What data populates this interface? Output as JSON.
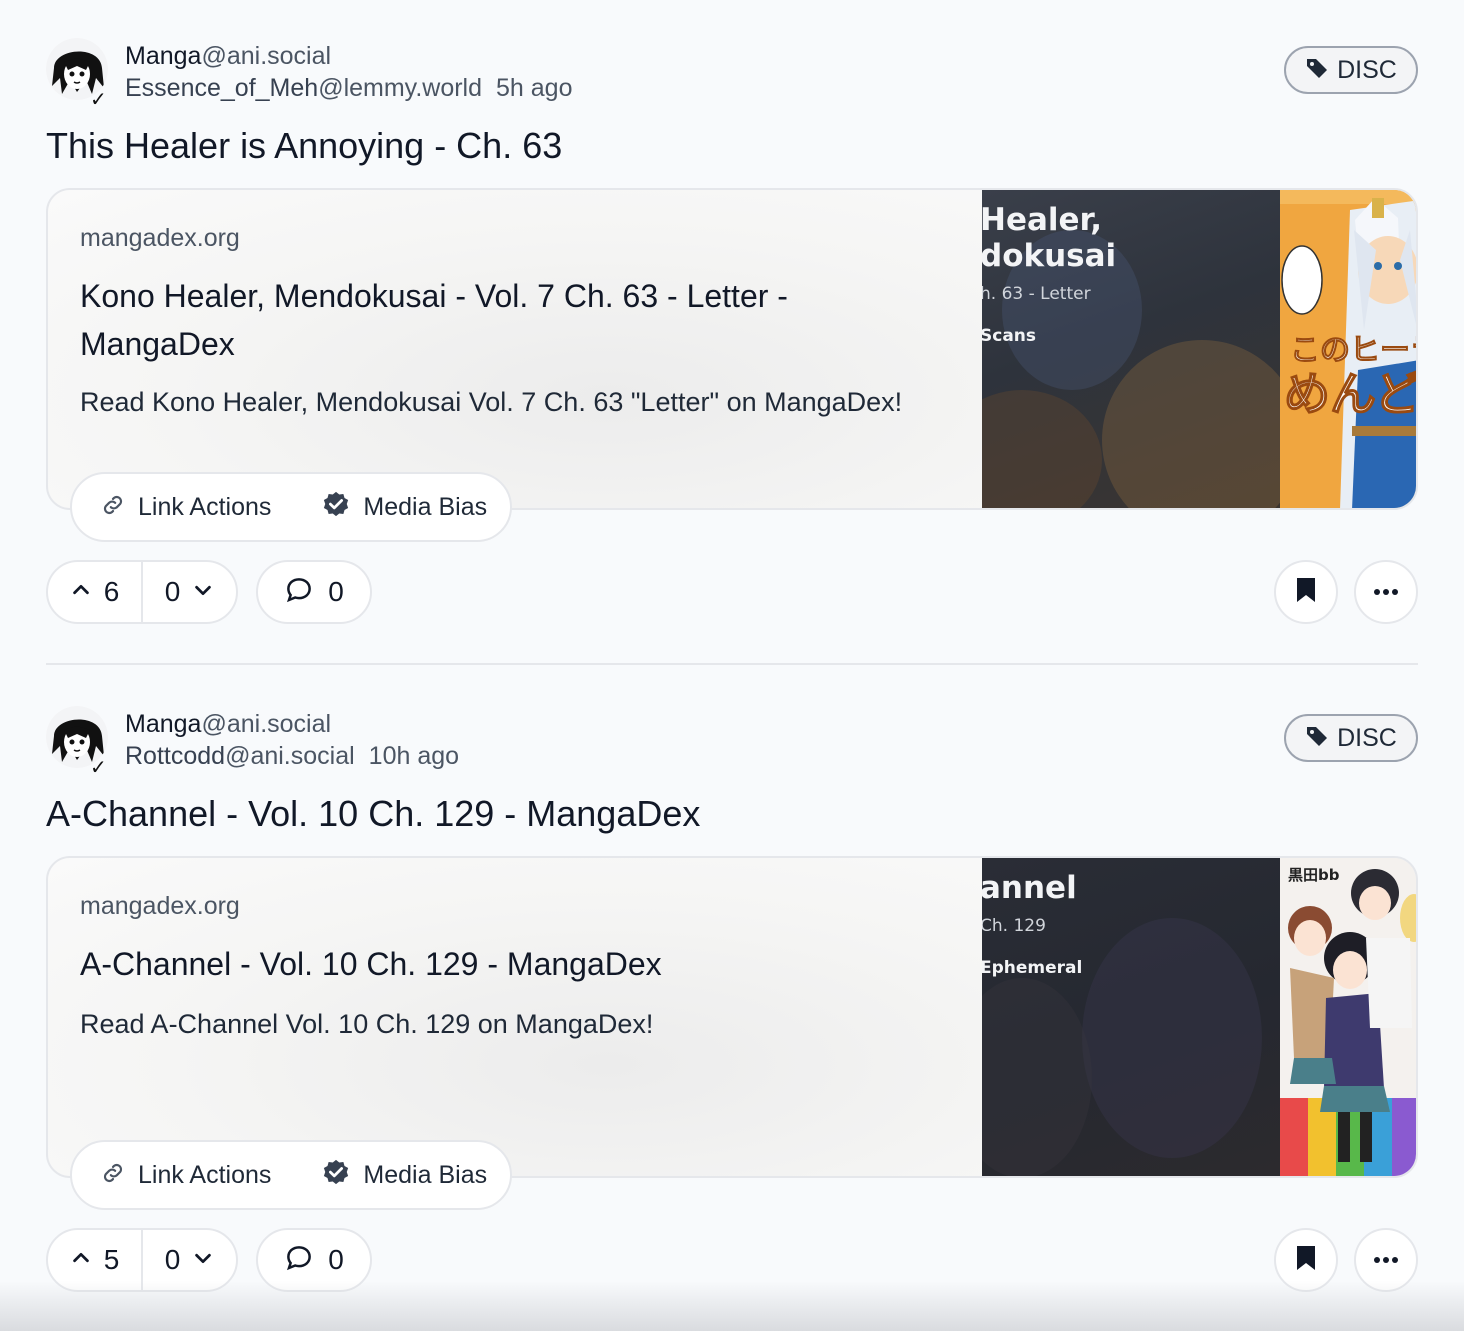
{
  "colors": {
    "background": "#f8fafc",
    "border": "#e5e7eb",
    "tag_border": "#9ca3af",
    "text_primary": "#111827",
    "text_muted": "#4b5563"
  },
  "posts": [
    {
      "community_name": "Manga",
      "community_instance": "@ani.social",
      "author_name": "Essence_of_Meh",
      "author_instance": "@lemmy.world",
      "time_ago": "5h ago",
      "tag_label": "DISC",
      "title": "This Healer is Annoying - Ch. 63",
      "card": {
        "domain": "mangadex.org",
        "title": "Kono Healer, Mendokusai - Vol. 7 Ch. 63 - Letter - MangaDex",
        "description": "Read Kono Healer, Mendokusai Vol. 7 Ch. 63 \"Letter\" on MangaDex!",
        "thumb_lines": [
          " Healer,",
          "dokusai",
          "h. 63 - Letter",
          "Scans"
        ]
      },
      "link_actions_label": "Link Actions",
      "media_bias_label": "Media Bias",
      "upvotes": "6",
      "downvotes": "0",
      "comments": "0"
    },
    {
      "community_name": "Manga",
      "community_instance": "@ani.social",
      "author_name": "Rottcodd",
      "author_instance": "@ani.social",
      "time_ago": "10h ago",
      "tag_label": "DISC",
      "title": "A-Channel - Vol. 10 Ch. 129 - MangaDex",
      "card": {
        "domain": "mangadex.org",
        "title": "A-Channel - Vol. 10 Ch. 129 - MangaDex",
        "description": "Read A-Channel Vol. 10 Ch. 129 on MangaDex!",
        "thumb_lines": [
          "annel",
          "Ch. 129",
          "Ephemeral"
        ],
        "cover_text": "黒田bb"
      },
      "link_actions_label": "Link Actions",
      "media_bias_label": "Media Bias",
      "upvotes": "5",
      "downvotes": "0",
      "comments": "0"
    }
  ],
  "icons": {
    "tag": "tag-icon",
    "link": "link-icon",
    "verified": "verified-check-icon",
    "upvote": "chevron-up-icon",
    "downvote": "chevron-down-icon",
    "comment": "comment-bubble-icon",
    "bookmark": "bookmark-icon",
    "more": "ellipsis-icon"
  }
}
